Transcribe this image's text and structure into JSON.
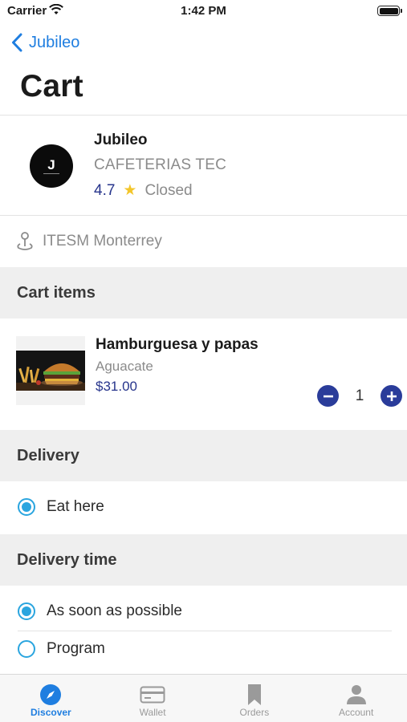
{
  "status_bar": {
    "carrier": "Carrier",
    "time": "1:42 PM"
  },
  "nav": {
    "back_label": "Jubileo",
    "title": "Cart"
  },
  "store": {
    "logo_letter": "J",
    "name": "Jubileo",
    "category": "CAFETERIAS TEC",
    "rating": "4.7",
    "status": "Closed"
  },
  "location": {
    "text": "ITESM Monterrey"
  },
  "sections": {
    "cart_items": "Cart items",
    "delivery": "Delivery",
    "delivery_time": "Delivery time"
  },
  "cart": {
    "items": [
      {
        "name": "Hamburguesa y papas",
        "variant": "Aguacate",
        "price": "$31.00",
        "quantity": "1"
      }
    ]
  },
  "delivery": {
    "options": [
      {
        "label": "Eat here",
        "selected": true
      }
    ]
  },
  "delivery_time": {
    "options": [
      {
        "label": "As soon as possible",
        "selected": true
      },
      {
        "label": "Program",
        "selected": false
      }
    ]
  },
  "tab_bar": {
    "tabs": [
      {
        "label": "Discover",
        "icon": "compass-icon",
        "active": true
      },
      {
        "label": "Wallet",
        "icon": "card-icon",
        "active": false
      },
      {
        "label": "Orders",
        "icon": "bookmark-icon",
        "active": false
      },
      {
        "label": "Account",
        "icon": "person-icon",
        "active": false
      }
    ]
  },
  "colors": {
    "accent_blue": "#1f7ee0",
    "navy": "#27358c",
    "radio_blue": "#2aa5df",
    "star": "#f3c62b",
    "section_bg": "#efefef"
  }
}
